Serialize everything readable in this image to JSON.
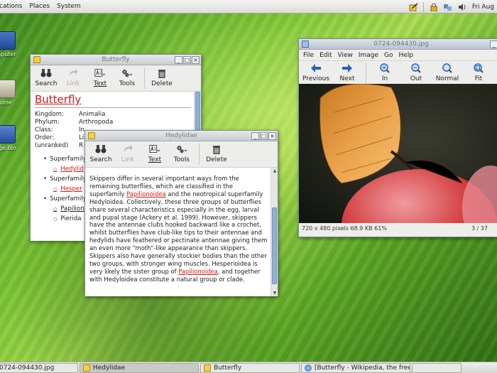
{
  "top_panel": {
    "menus": [
      "cations",
      "Places",
      "System"
    ],
    "clock": "Fri Aug"
  },
  "desktop": {
    "icons": [
      {
        "label": "mputer"
      },
      {
        "label": "ome"
      },
      {
        "label": "age.bin"
      }
    ]
  },
  "butterfly_window": {
    "title": "Butterfly",
    "toolbar": {
      "search": "Search",
      "link": "Link",
      "text": "Text",
      "tools": "Tools",
      "delete": "Delete"
    },
    "heading": "Butterfly",
    "infobox": [
      {
        "key": "Kingdom:",
        "value": "Animalia"
      },
      {
        "key": "Phylum:",
        "value": "Arthropoda"
      },
      {
        "key": "Class:",
        "value": "In"
      },
      {
        "key": "Order:",
        "value": "Li"
      },
      {
        "key": "(unranked)",
        "value": "R"
      }
    ],
    "list": {
      "superfamily_label": "Superfamily",
      "sub_1": "Hedylid",
      "sub_2": "Hesper",
      "sub_3": "Papilion",
      "sub_4": "Pierida"
    }
  },
  "hedylidae_window": {
    "title": "Hedylidae",
    "toolbar": {
      "search": "Search",
      "link": "Link",
      "text": "Text",
      "tools": "Tools",
      "delete": "Delete"
    },
    "para": {
      "t1": "Skippers differ in several important ways from the remaining butterflies, which are classified in the superfamily ",
      "l1": "Papilionoidea",
      "t2": " and the neotropical superfamily Hedyloidea. Collectively, these three groups of butterflies share several characteristics especially in the egg, larval and pupal stage (Ackery et al. 1999). However, skippers have the antennae clubs hooked backward like a crochet, whilst butterflies have club-like tips to their antennae and hedylids have feathered or pectinate antennae giving them an even more \"moth\"-like appearance than skippers. Skippers also have generally stockier bodies than the other two groups, with stronger wing muscles. Hesperioidea is very likely the sister group of ",
      "l2": "Papilionoidea",
      "t3": ", and together with Hedyloidea constitute a natural group or clade."
    }
  },
  "eog_window": {
    "title": "0724-094430.jpg",
    "menus": [
      "File",
      "Edit",
      "View",
      "Image",
      "Go",
      "Help"
    ],
    "toolbar": {
      "previous": "Previous",
      "next": "Next",
      "in": "In",
      "out": "Out",
      "normal": "Normal",
      "fit": "Fit"
    },
    "status_left": "720 x 480 pixels  68.9 KB  61%",
    "status_right": "3 / 37"
  },
  "taskbar": {
    "tasks": [
      {
        "label": "0724-094430.jpg"
      },
      {
        "label": "Hedylidae"
      },
      {
        "label": "Butterfly"
      },
      {
        "label": "[Butterfly - Wikipedia, the free..."
      }
    ]
  },
  "colors": {
    "link_red": "#d01818",
    "selection_blue": "#8fb0d8",
    "desktop_green": "#7cc632"
  }
}
